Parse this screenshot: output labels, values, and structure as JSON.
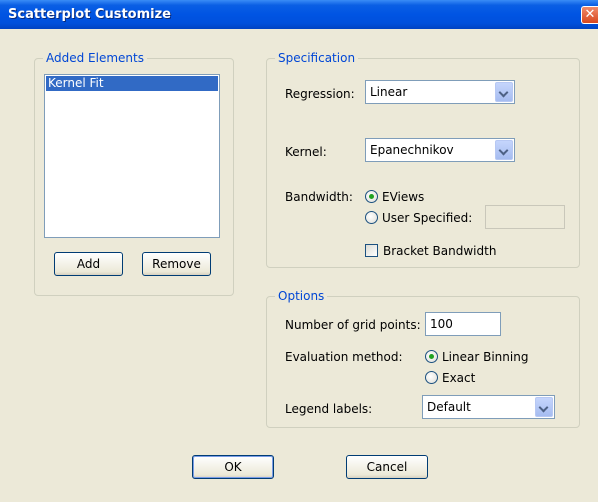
{
  "window": {
    "title": "Scatterplot Customize",
    "close_glyph": "✕"
  },
  "added_elements": {
    "group_title": "Added Elements",
    "items": [
      "Kernel Fit"
    ],
    "selected_index": 0,
    "add_label": "Add",
    "remove_label": "Remove"
  },
  "specification": {
    "group_title": "Specification",
    "regression_label": "Regression:",
    "regression_value": "Linear",
    "kernel_label": "Kernel:",
    "kernel_value": "Epanechnikov",
    "bandwidth_label": "Bandwidth:",
    "bandwidth_options": [
      {
        "label": "EViews",
        "checked": true
      },
      {
        "label": "User Specified:",
        "checked": false
      }
    ],
    "user_specified_value": "",
    "bracket_bandwidth_label": "Bracket Bandwidth",
    "bracket_bandwidth_checked": false
  },
  "options": {
    "group_title": "Options",
    "grid_points_label": "Number of grid points:",
    "grid_points_value": "100",
    "evaluation_label": "Evaluation method:",
    "evaluation_options": [
      {
        "label": "Linear Binning",
        "checked": true
      },
      {
        "label": "Exact",
        "checked": false
      }
    ],
    "legend_label": "Legend labels:",
    "legend_value": "Default"
  },
  "footer": {
    "ok_label": "OK",
    "cancel_label": "Cancel"
  },
  "colors": {
    "titlebar": "#0054e3",
    "group_title": "#0046d5",
    "selection": "#316ac5",
    "dialog_bg": "#ece9d8"
  }
}
